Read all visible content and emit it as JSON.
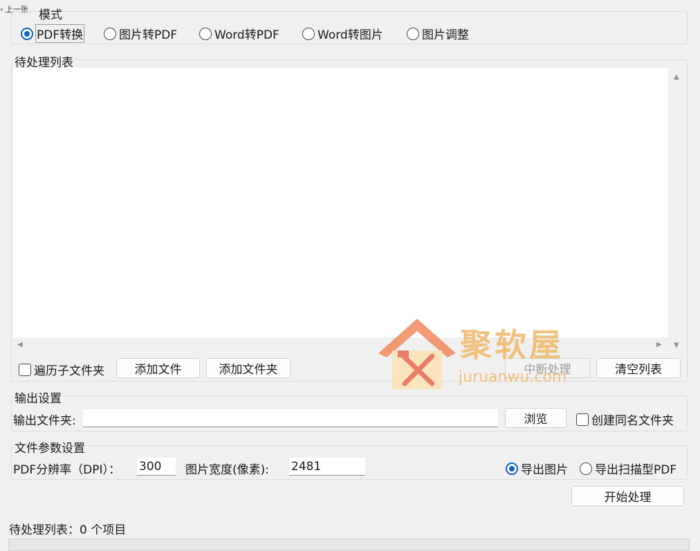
{
  "nav": {
    "prev_label": "上一张"
  },
  "mode": {
    "title": "模式",
    "options": [
      {
        "label": "PDF转换",
        "checked": true
      },
      {
        "label": "图片转PDF",
        "checked": false
      },
      {
        "label": "Word转PDF",
        "checked": false
      },
      {
        "label": "Word转图片",
        "checked": false
      },
      {
        "label": "图片调整",
        "checked": false
      }
    ]
  },
  "queue": {
    "title": "待处理列表",
    "items": [],
    "recursive_label": "遍历子文件夹",
    "add_file_label": "添加文件",
    "add_folder_label": "添加文件夹",
    "stop_label": "中断处理",
    "clear_label": "清空列表"
  },
  "output": {
    "title": "输出设置",
    "folder_label": "输出文件夹:",
    "folder_value": "",
    "browse_label": "浏览",
    "same_name_label": "创建同名文件夹"
  },
  "params": {
    "title": "文件参数设置",
    "dpi_label": "PDF分辨率（DPI）：",
    "dpi_value": "300",
    "width_label": "图片宽度(像素):",
    "width_value": "2481",
    "export_image_label": "导出图片",
    "export_scan_pdf_label": "导出扫描型PDF",
    "export_image_checked": true
  },
  "start_label": "开始处理",
  "status": {
    "text": "待处理列表：0 个项目",
    "progress": 0
  },
  "watermark": {
    "title": "聚软屋",
    "domain": "juruanwu.com"
  },
  "colors": {
    "accent": "#0a64c8",
    "background": "#f0f0f0",
    "watermark": "#f0b86a"
  },
  "icons": {
    "prev": "chevron-left-icon",
    "watermark": "house-tools-logo"
  }
}
